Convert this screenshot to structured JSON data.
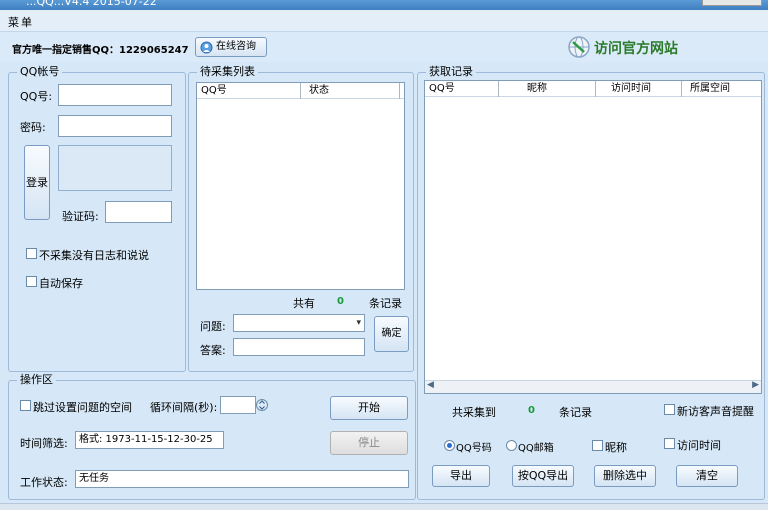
{
  "window": {
    "title": "...QQ...V4.4 2015-07-22"
  },
  "menu": {
    "items": [
      "菜单"
    ]
  },
  "toolbar": {
    "sales_info": "官方唯一指定销售QQ：1229065247",
    "consult_button": "在线咨询",
    "official_site": "访问官方网站"
  },
  "qq_account": {
    "legend": "QQ帐号",
    "qq_label": "QQ号:",
    "qq_value": "",
    "password_label": "密码:",
    "password_value": "",
    "login_button": "登录",
    "captcha_label": "验证码:",
    "captcha_value": "",
    "skip_no_log_checkbox": "不采集没有日志和说说",
    "skip_no_log_checked": false,
    "auto_save_checkbox": "自动保存",
    "auto_save_checked": false
  },
  "pending": {
    "legend": "待采集列表",
    "columns": [
      "QQ号",
      "状态"
    ],
    "total_prefix": "共有",
    "total_count": "0",
    "total_suffix": "条记录",
    "question_label": "问题:",
    "question_value": "",
    "answer_label": "答案:",
    "answer_value": "",
    "confirm_button": "确定"
  },
  "records": {
    "legend": "获取记录",
    "columns": [
      "QQ号",
      "昵称",
      "访问时间",
      "所属空间"
    ],
    "collected_prefix": "共采集到",
    "collected_count": "0",
    "collected_suffix": "条记录",
    "new_visitor_checkbox": "新访客声音提醒",
    "new_visitor_checked": false,
    "radio_qq": "QQ号码",
    "radio_email": "QQ邮箱",
    "radio_selected": "radio_qq",
    "nickname_checkbox": "昵称",
    "visit_time_checkbox": "访问时间",
    "export_button": "导出",
    "export_by_qq_button": "按QQ导出",
    "delete_selected_button": "删除选中",
    "clear_button": "清空"
  },
  "operation": {
    "legend": "操作区",
    "skip_question_checkbox": "跳过设置问题的空间",
    "skip_question_checked": false,
    "interval_label": "循环间隔(秒):",
    "interval_value": "",
    "start_button": "开始",
    "time_filter_label": "时间筛选:",
    "time_filter_value": "格式: 1973-11-15-12-30-25",
    "stop_button": "停止",
    "status_label": "工作状态:",
    "status_value": "无任务"
  },
  "colors": {
    "background": "#d6e8f7",
    "border": "#9dbad8",
    "count_green": "#1a9a3a",
    "title_bar": "#3f7fc0"
  }
}
